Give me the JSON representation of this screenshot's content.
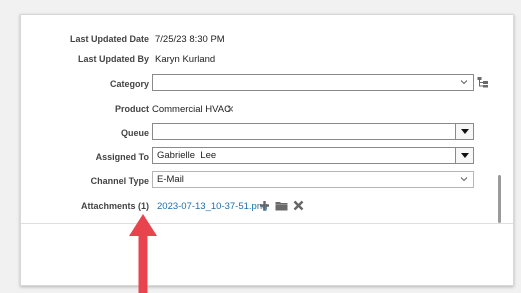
{
  "last_updated_date": {
    "label": "Last Updated Date",
    "value": "7/25/23 8:30 PM"
  },
  "last_updated_by": {
    "label": "Last Updated By",
    "value": "Karyn Kurland"
  },
  "category": {
    "label": "Category",
    "value": ""
  },
  "product": {
    "label": "Product",
    "value": "Commercial HVAC",
    "remove_glyph": "×"
  },
  "queue": {
    "label": "Queue",
    "value": ""
  },
  "assigned_to": {
    "label": "Assigned To",
    "value": "Gabrielle  Lee"
  },
  "channel_type": {
    "label": "Channel Type",
    "value": "E-Mail"
  },
  "attachments": {
    "label": "Attachments (1)",
    "file": "2023-07-13_10-37-51.png"
  },
  "colors": {
    "link": "#1d6ea8",
    "arrow": "#e8444e"
  }
}
